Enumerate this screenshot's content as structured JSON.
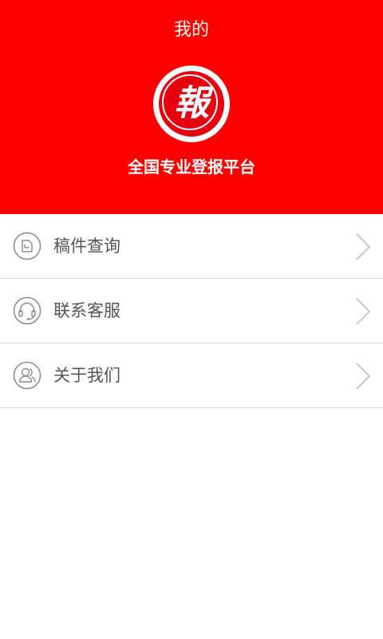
{
  "header": {
    "title": "我的",
    "logo_char": "報",
    "slogan": "全国专业登报平台"
  },
  "menu": {
    "items": [
      {
        "label": "稿件查询",
        "icon": "document-icon"
      },
      {
        "label": "联系客服",
        "icon": "headset-icon"
      },
      {
        "label": "关于我们",
        "icon": "users-icon"
      }
    ]
  },
  "colors": {
    "accent": "#ff0000",
    "label": "#555555",
    "icon": "#8a8a8a",
    "divider": "#dcdcdc"
  }
}
